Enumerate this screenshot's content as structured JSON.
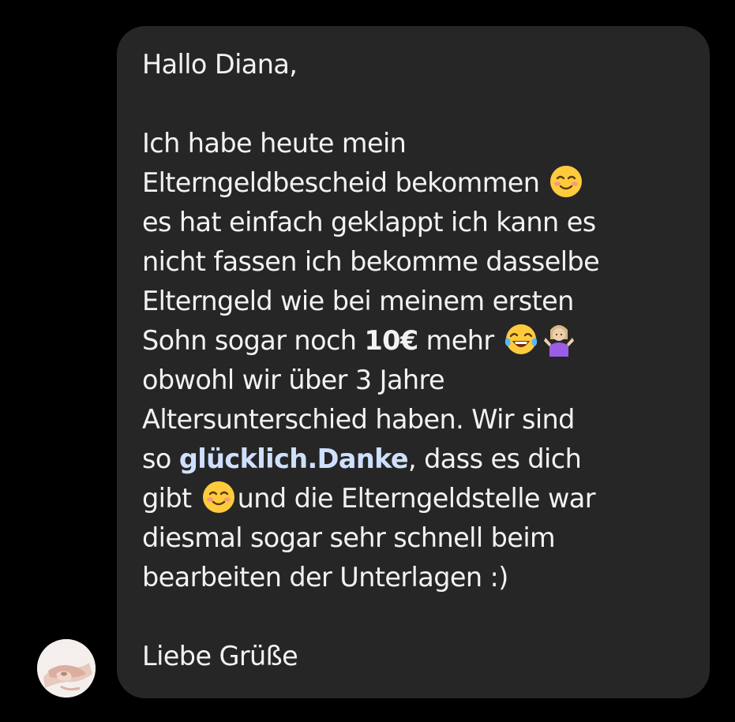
{
  "message": {
    "greeting": "Hallo Diana,",
    "lines": [
      {
        "text": "Ich habe heute mein"
      },
      {
        "text": "Elterngeldbescheid bekommen ",
        "emoji": "smiling-face-icon"
      },
      {
        "text": "es hat einfach geklappt ich kann es"
      },
      {
        "text": "nicht fassen ich bekomme dasselbe"
      },
      {
        "text": "Elterngeld wie bei meinem ersten"
      },
      {
        "pre": "Sohn sogar noch ",
        "bold": "10€",
        "post": " mehr "
      },
      {
        "text": "obwohl wir über 3 Jahre"
      },
      {
        "text": "Altersunterschied haben. Wir sind"
      },
      {
        "pre": "so ",
        "mention": "glücklich.Danke",
        "post": ", dass es dich"
      },
      {
        "pre": "gibt ",
        "post": "und die Elterngeldstelle war"
      },
      {
        "text": "diesmal sogar sehr schnell beim"
      },
      {
        "text": "bearbeiten der Unterlagen :)"
      }
    ],
    "closing": "Liebe Grüße"
  },
  "avatar": {
    "name": "sender-avatar"
  },
  "colors": {
    "background": "#000000",
    "bubble": "#262626",
    "text": "#f2f2f2",
    "mention": "#cfe0ff"
  }
}
